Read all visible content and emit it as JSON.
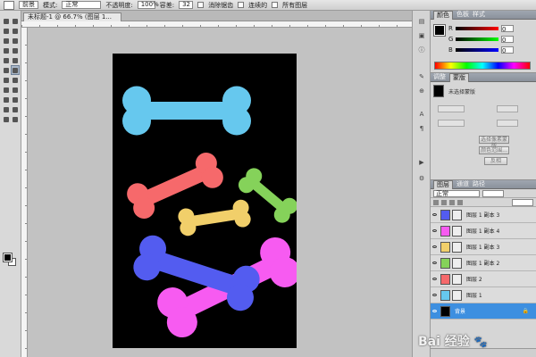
{
  "app": {
    "accent_selected": "#3d8fe0"
  },
  "options_bar": {
    "preset_label": "前景",
    "mode_label": "模式:",
    "mode_value": "正常",
    "opacity_label": "不透明度:",
    "opacity_value": "100%",
    "tolerance_label": "容差:",
    "tolerance_value": "32",
    "antialias_label": "消除锯齿",
    "contiguous_label": "连续的",
    "all_layers_label": "所有图层"
  },
  "document_tab": {
    "title": "未标题-1 @ 66.7% (图层 1..."
  },
  "canvas": {
    "background": "#000000",
    "bones": [
      {
        "name": "bone-light-blue",
        "color": "#66c8ee"
      },
      {
        "name": "bone-salmon",
        "color": "#f6696b"
      },
      {
        "name": "bone-green",
        "color": "#85d25a"
      },
      {
        "name": "bone-yellow",
        "color": "#f1cf6a"
      },
      {
        "name": "bone-magenta",
        "color": "#f75bf1"
      },
      {
        "name": "bone-blue",
        "color": "#535cf0"
      }
    ]
  },
  "panels": {
    "color_panel": {
      "tabs": [
        "颜色",
        "色板",
        "样式"
      ],
      "channels": [
        "R",
        "G",
        "B"
      ],
      "values": [
        "0",
        "0",
        "0"
      ]
    },
    "adjustments_panel": {
      "tabs": [
        "调整",
        "蒙版"
      ],
      "title": "未选择蒙版",
      "buttons": [
        "选择像素蒙版",
        "颜色范围...",
        "反相"
      ]
    },
    "layers_panel": {
      "tabs": [
        "图层",
        "通道",
        "路径"
      ],
      "blend_mode": "正常",
      "layers": [
        {
          "name": "图层 1 副本 3",
          "thumb_color": "#535cf0",
          "selected": false
        },
        {
          "name": "图层 1 副本 4",
          "thumb_color": "#f75bf1",
          "selected": false
        },
        {
          "name": "图层 1 副本 3",
          "thumb_color": "#f1cf6a",
          "selected": false
        },
        {
          "name": "图层 1 副本 2",
          "thumb_color": "#85d25a",
          "selected": false
        },
        {
          "name": "图层 2",
          "thumb_color": "#f6696b",
          "selected": false
        },
        {
          "name": "图层 1",
          "thumb_color": "#66c8ee",
          "selected": false
        },
        {
          "name": "背景",
          "thumb_color": "#000000",
          "selected": true
        }
      ]
    }
  },
  "watermark": {
    "text": "Bai  经验",
    "icon": "paw-icon"
  }
}
